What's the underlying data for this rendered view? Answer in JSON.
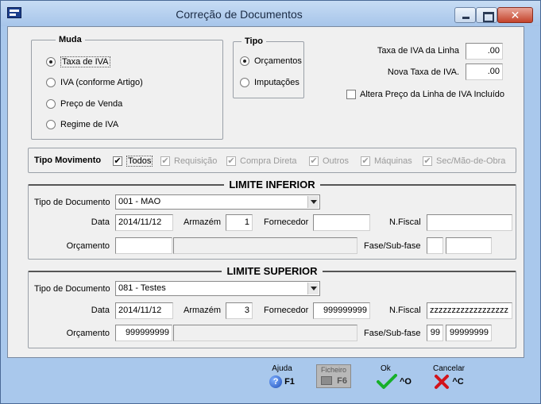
{
  "window": {
    "title": "Correção de Documentos"
  },
  "muda": {
    "title": "Muda",
    "options": [
      {
        "label": "Taxa de IVA",
        "selected": true
      },
      {
        "label": "IVA (conforme Artigo)",
        "selected": false
      },
      {
        "label": "Preço de Venda",
        "selected": false
      },
      {
        "label": "Regime de IVA",
        "selected": false
      }
    ]
  },
  "tipo": {
    "title": "Tipo",
    "options": [
      {
        "label": "Orçamentos",
        "selected": true
      },
      {
        "label": "Imputações",
        "selected": false
      }
    ]
  },
  "iva": {
    "taxa_label": "Taxa de IVA da Linha",
    "taxa_value": ".00",
    "nova_label": "Nova Taxa de IVA.",
    "nova_value": ".00",
    "altera_label": "Altera Preço da Linha de IVA Incluído",
    "altera_checked": false
  },
  "movimento": {
    "title": "Tipo Movimento",
    "items": [
      {
        "label": "Todos",
        "checked": true,
        "enabled": true
      },
      {
        "label": "Requisição",
        "checked": true,
        "enabled": false
      },
      {
        "label": "Compra Direta",
        "checked": true,
        "enabled": false
      },
      {
        "label": "Outros",
        "checked": true,
        "enabled": false
      },
      {
        "label": "Máquinas",
        "checked": true,
        "enabled": false
      },
      {
        "label": "Sec/Mão-de-Obra",
        "checked": true,
        "enabled": false
      }
    ]
  },
  "labels": {
    "tipo_documento": "Tipo de Documento",
    "data": "Data",
    "armazem": "Armazém",
    "fornecedor": "Fornecedor",
    "nfiscal": "N.Fiscal",
    "orcamento": "Orçamento",
    "fase": "Fase/Sub-fase"
  },
  "inferior": {
    "title": "LIMITE INFERIOR",
    "tipo_documento": "001 - MAO",
    "data": "2014/11/12",
    "armazem": "1",
    "fornecedor": "",
    "nfiscal": "",
    "orcamento": "",
    "orcamento_desc": "",
    "fase": "",
    "subfase": ""
  },
  "superior": {
    "title": "LIMITE SUPERIOR",
    "tipo_documento": "081 - Testes",
    "data": "2014/11/12",
    "armazem": "3",
    "fornecedor": "999999999",
    "nfiscal": "zzzzzzzzzzzzzzzzzz",
    "orcamento": "999999999",
    "orcamento_desc": "",
    "fase": "99",
    "subfase": "99999999"
  },
  "footer": {
    "ajuda_label": "Ajuda",
    "ajuda_key": "F1",
    "ficheiro_label": "Ficheiro",
    "ficheiro_key": "F6",
    "ok_label": "Ok",
    "ok_key": "^O",
    "cancelar_label": "Cancelar",
    "cancelar_key": "^C"
  }
}
